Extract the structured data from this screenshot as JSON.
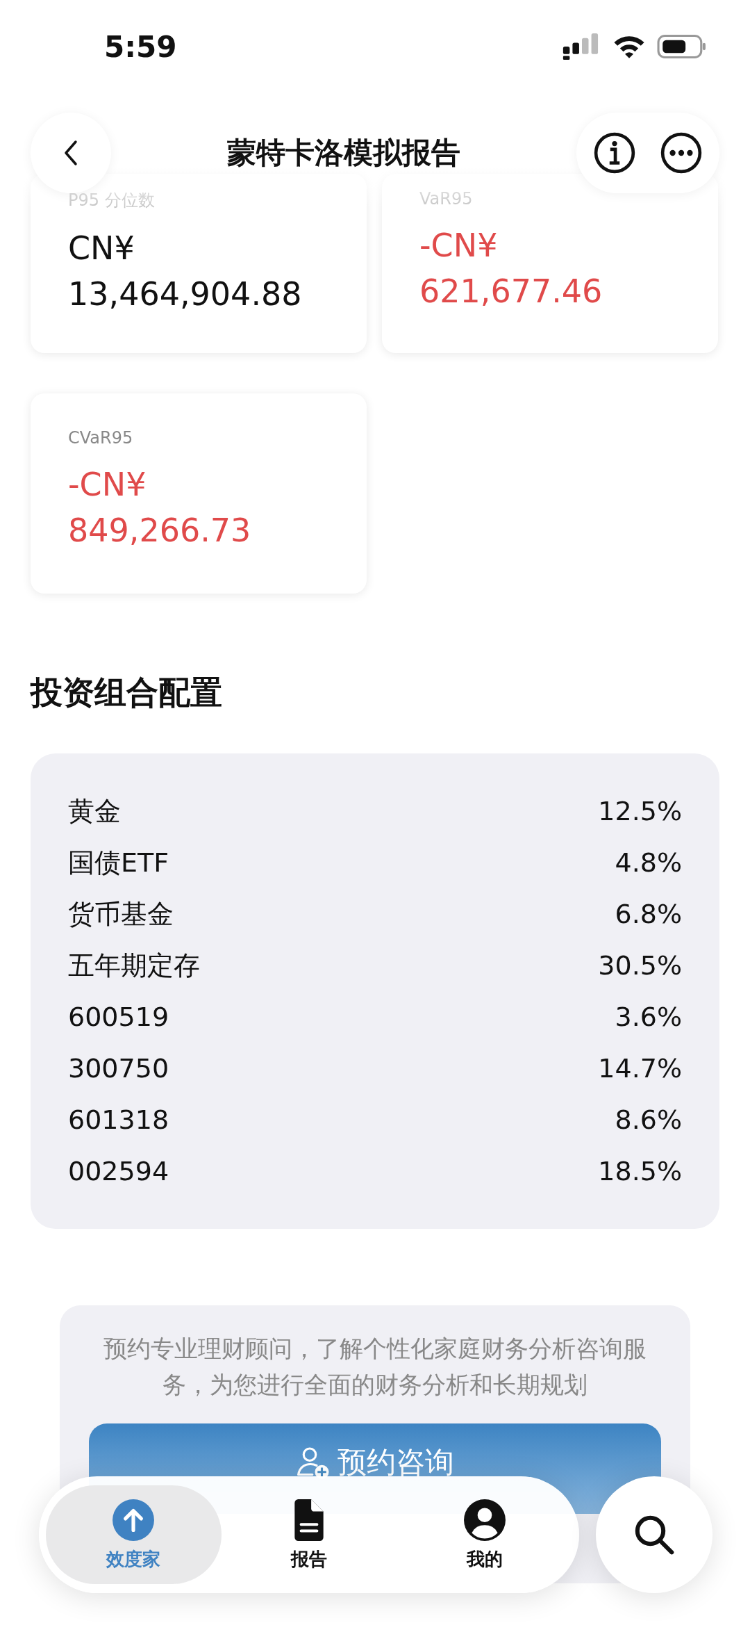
{
  "status_bar": {
    "time": "5:59"
  },
  "header": {
    "title": "蒙特卡洛模拟报告"
  },
  "metrics": [
    {
      "label": "P95 分位数",
      "currency": "CN¥",
      "value": "13,464,904.88",
      "negative": false
    },
    {
      "label": "VaR95",
      "currency": "-CN¥",
      "value": "621,677.46",
      "negative": true
    },
    {
      "label": "CVaR95",
      "currency": "-CN¥",
      "value": "849,266.73",
      "negative": true
    }
  ],
  "allocation": {
    "title": "投资组合配置",
    "rows": [
      {
        "name": "黄金",
        "share": "12.5%"
      },
      {
        "name": "国债ETF",
        "share": "4.8%"
      },
      {
        "name": "货币基金",
        "share": "6.8%"
      },
      {
        "name": "五年期定存",
        "share": "30.5%"
      },
      {
        "name": "600519",
        "share": "3.6%"
      },
      {
        "name": "300750",
        "share": "14.7%"
      },
      {
        "name": "601318",
        "share": "8.6%"
      },
      {
        "name": "002594",
        "share": "18.5%"
      }
    ]
  },
  "consult": {
    "text": "预约专业理财顾问，了解个性化家庭财务分析咨询服务，为您进行全面的财务分析和长期规划",
    "button": "预约咨询"
  },
  "tab_bar": {
    "tabs": [
      {
        "kind": "home",
        "label": "效度家",
        "selected": true
      },
      {
        "kind": "report",
        "label": "报告",
        "selected": false
      },
      {
        "kind": "profile",
        "label": "我的",
        "selected": false
      }
    ]
  }
}
